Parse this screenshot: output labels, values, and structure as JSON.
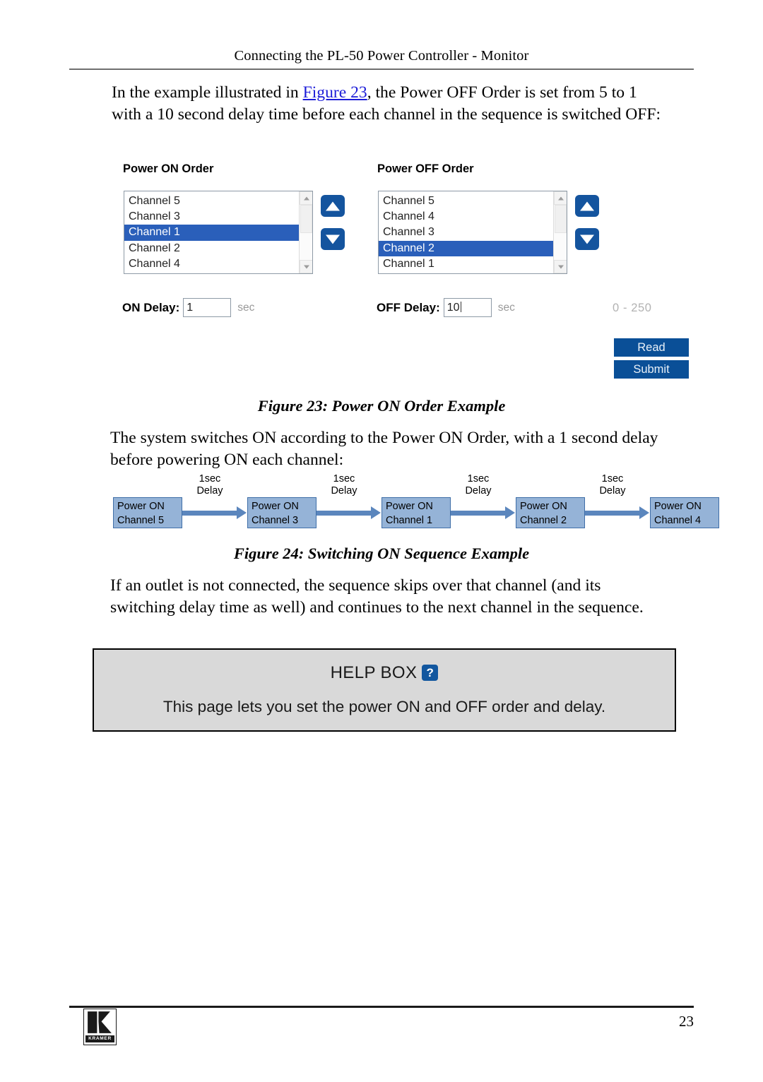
{
  "header": {
    "title": "Connecting the PL-50 Power Controller - Monitor"
  },
  "paragraphs": {
    "p1_before_link": "In the example illustrated in ",
    "p1_link": "Figure 23",
    "p1_after_link": ", the Power OFF Order is set from 5 to 1 with a 10 second delay time before each channel in the sequence is switched OFF:",
    "p2": "The system switches ON according to the Power ON Order, with a 1 second delay before powering ON each channel:",
    "p3": "If an outlet is not connected, the sequence skips over that channel (and its switching delay time as well) and continues to the next channel in the sequence."
  },
  "screenshot": {
    "power_on": {
      "label": "Power ON Order",
      "items": [
        {
          "label": "Channel 5",
          "selected": false
        },
        {
          "label": "Channel 3",
          "selected": false
        },
        {
          "label": "Channel 1",
          "selected": true
        },
        {
          "label": "Channel 2",
          "selected": false
        },
        {
          "label": "Channel 4",
          "selected": false
        }
      ],
      "move_up_icon": "triangle-up-icon",
      "move_down_icon": "triangle-down-icon",
      "delay_label": "ON Delay:",
      "delay_value": "1",
      "delay_unit": "sec"
    },
    "power_off": {
      "label": "Power OFF Order",
      "items": [
        {
          "label": "Channel 5",
          "selected": false
        },
        {
          "label": "Channel 4",
          "selected": false
        },
        {
          "label": "Channel 3",
          "selected": false
        },
        {
          "label": "Channel 2",
          "selected": true
        },
        {
          "label": "Channel 1",
          "selected": false
        }
      ],
      "move_up_icon": "triangle-up-icon",
      "move_down_icon": "triangle-down-icon",
      "delay_label": "OFF Delay:",
      "delay_value": "10",
      "delay_unit": "sec"
    },
    "range_hint": "0 - 250",
    "read_label": "Read",
    "submit_label": "Submit",
    "colors": {
      "selection_blue": "#2a5fba",
      "button_blue": "#0a4f97",
      "move_button_blue": "#14549e",
      "unit_grey": "#9a9a9a",
      "hint_grey": "#b2b2b2"
    }
  },
  "captions": {
    "figure_23": "Figure 23: Power ON Order Example",
    "figure_24": "Figure 24: Switching ON Sequence Example"
  },
  "sequence": {
    "nodes": [
      {
        "line1": "Power ON",
        "line2": "Channel 5"
      },
      {
        "line1": "Power ON",
        "line2": "Channel 3"
      },
      {
        "line1": "Power ON",
        "line2": "Channel 1"
      },
      {
        "line1": "Power ON",
        "line2": "Channel 2"
      },
      {
        "line1": "Power ON",
        "line2": "Channel 4"
      }
    ],
    "delays": [
      {
        "line1": "1sec",
        "line2": "Delay"
      },
      {
        "line1": "1sec",
        "line2": "Delay"
      },
      {
        "line1": "1sec",
        "line2": "Delay"
      },
      {
        "line1": "1sec",
        "line2": "Delay"
      }
    ],
    "colors": {
      "node_fill": "#95b3d7",
      "node_border": "#3f6ea8",
      "arrow": "#5b86bd"
    }
  },
  "help_box": {
    "title": "HELP BOX",
    "icon": "question-mark-icon",
    "text": "This page lets you set the power ON and OFF order and delay.",
    "background": "#d9d9d9",
    "icon_color": "#12579f"
  },
  "footer": {
    "logo_word": "KRAMER",
    "page_number": "23"
  }
}
